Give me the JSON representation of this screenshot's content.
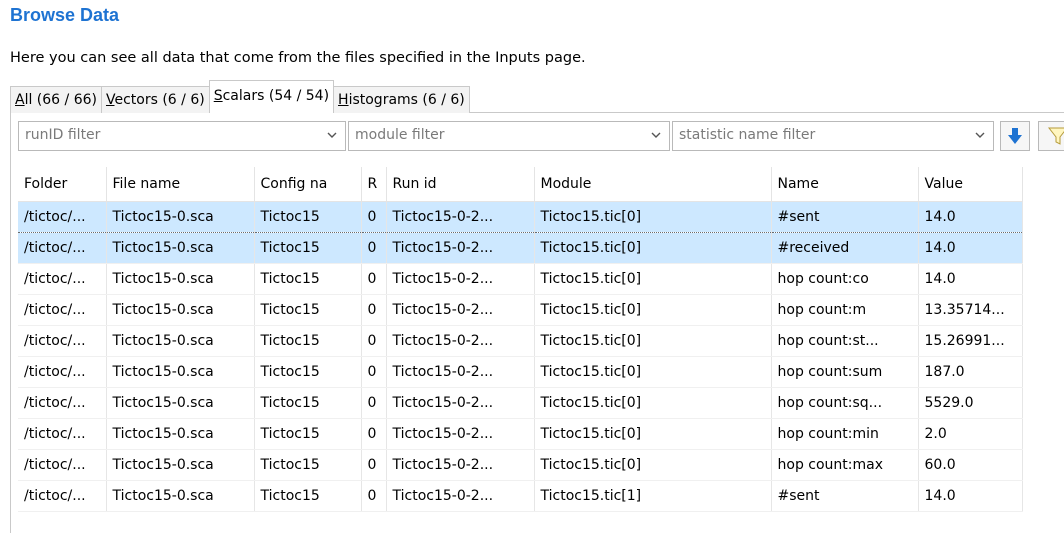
{
  "header": {
    "title": "Browse Data",
    "description": "Here you can see all data that come from the files specified in the Inputs page."
  },
  "tabs": [
    {
      "mnemonic": "A",
      "rest": "ll (66 / 66)",
      "active": false
    },
    {
      "mnemonic": "V",
      "rest": "ectors (6 / 6)",
      "active": false
    },
    {
      "mnemonic": "S",
      "rest": "calars (54 / 54)",
      "active": true
    },
    {
      "mnemonic": "H",
      "rest": "istograms (6 / 6)",
      "active": false
    }
  ],
  "filters": {
    "runid_placeholder": "runID filter",
    "module_placeholder": "module filter",
    "statistic_placeholder": "statistic name filter"
  },
  "table": {
    "columns": [
      "Folder",
      "File name",
      "Config na",
      "R",
      "Run id",
      "Module",
      "Name",
      "Value"
    ],
    "rows": [
      [
        "/tictoc/...",
        "Tictoc15-0.sca",
        "Tictoc15",
        "0",
        "Tictoc15-0-2...",
        "Tictoc15.tic[0]",
        "#sent",
        "14.0"
      ],
      [
        "/tictoc/...",
        "Tictoc15-0.sca",
        "Tictoc15",
        "0",
        "Tictoc15-0-2...",
        "Tictoc15.tic[0]",
        "#received",
        "14.0"
      ],
      [
        "/tictoc/...",
        "Tictoc15-0.sca",
        "Tictoc15",
        "0",
        "Tictoc15-0-2...",
        "Tictoc15.tic[0]",
        "hop count:co",
        "14.0"
      ],
      [
        "/tictoc/...",
        "Tictoc15-0.sca",
        "Tictoc15",
        "0",
        "Tictoc15-0-2...",
        "Tictoc15.tic[0]",
        "hop count:m",
        "13.35714..."
      ],
      [
        "/tictoc/...",
        "Tictoc15-0.sca",
        "Tictoc15",
        "0",
        "Tictoc15-0-2...",
        "Tictoc15.tic[0]",
        "hop count:st...",
        "15.26991..."
      ],
      [
        "/tictoc/...",
        "Tictoc15-0.sca",
        "Tictoc15",
        "0",
        "Tictoc15-0-2...",
        "Tictoc15.tic[0]",
        "hop count:sum",
        "187.0"
      ],
      [
        "/tictoc/...",
        "Tictoc15-0.sca",
        "Tictoc15",
        "0",
        "Tictoc15-0-2...",
        "Tictoc15.tic[0]",
        "hop count:sq...",
        "5529.0"
      ],
      [
        "/tictoc/...",
        "Tictoc15-0.sca",
        "Tictoc15",
        "0",
        "Tictoc15-0-2...",
        "Tictoc15.tic[0]",
        "hop count:min",
        "2.0"
      ],
      [
        "/tictoc/...",
        "Tictoc15-0.sca",
        "Tictoc15",
        "0",
        "Tictoc15-0-2...",
        "Tictoc15.tic[0]",
        "hop count:max",
        "60.0"
      ],
      [
        "/tictoc/...",
        "Tictoc15-0.sca",
        "Tictoc15",
        "0",
        "Tictoc15-0-2...",
        "Tictoc15.tic[1]",
        "#sent",
        "14.0"
      ]
    ],
    "selected_rows": [
      0,
      1
    ]
  },
  "colors": {
    "title": "#1e73d2",
    "selection": "#cde8ff",
    "sort_icon": "#1e73d2"
  },
  "icons": {
    "sort": "sort-down-arrow-icon",
    "filter": "funnel-icon",
    "dropdown": "chevron-down-icon"
  }
}
